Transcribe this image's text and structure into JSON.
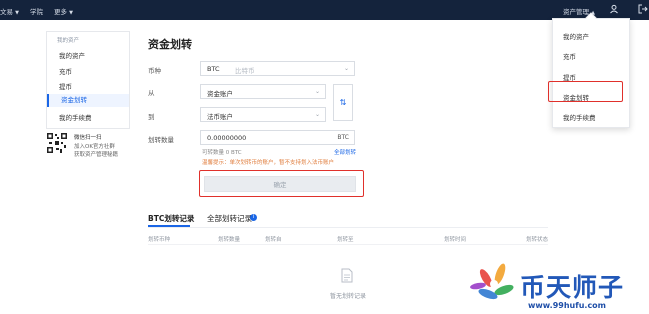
{
  "topnav": {
    "left_items": [
      "文易",
      "学院",
      "更多"
    ],
    "right_asset_label": "资产管理",
    "icons": [
      "user-icon",
      "logout-icon"
    ]
  },
  "sidebar": {
    "head": "我的资产",
    "items": [
      {
        "label": "我的资产",
        "active": false
      },
      {
        "label": "充币",
        "active": false
      },
      {
        "label": "提币",
        "active": false
      },
      {
        "label": "资金划转",
        "active": true
      },
      {
        "label": "我的手续费",
        "active": false
      }
    ]
  },
  "qr_promo": {
    "title": "微信扫一扫",
    "line2": "加入OK官方社群",
    "line3": "获取资产管理秘籍"
  },
  "main": {
    "title": "资金划转",
    "coin_label": "币种",
    "coin_value": "BTC",
    "coin_name": "比特币",
    "from_label": "从",
    "from_value": "资金账户",
    "to_label": "到",
    "to_value": "法币账户",
    "amount_label": "划转数量",
    "amount_value": "0.00000000",
    "amount_unit": "BTC",
    "available": "可转数量  0 BTC",
    "transfer_all": "全部划转",
    "tip": "温馨提示：单次划转币的账户，暂不支持划入法币账户",
    "confirm_label": "确定"
  },
  "records": {
    "tabs": [
      {
        "label": "BTC划转记录",
        "active": true
      },
      {
        "label": "全部划转记录",
        "active": false
      }
    ],
    "info_glyph": "i",
    "columns": [
      "划转币种",
      "划转数量",
      "划转自",
      "划转至",
      "划转时间",
      "划转状态"
    ],
    "empty_text": "暂无划转记录"
  },
  "dropdown": {
    "items": [
      "我的资产",
      "充币",
      "提币",
      "资金划转",
      "我的手续费"
    ]
  },
  "watermark": {
    "brand": "币天师子",
    "url": "www.99hufu.com"
  },
  "colors": {
    "topbar": "#14233c",
    "accent": "#1a66e6",
    "highlight": "#e0302b"
  }
}
